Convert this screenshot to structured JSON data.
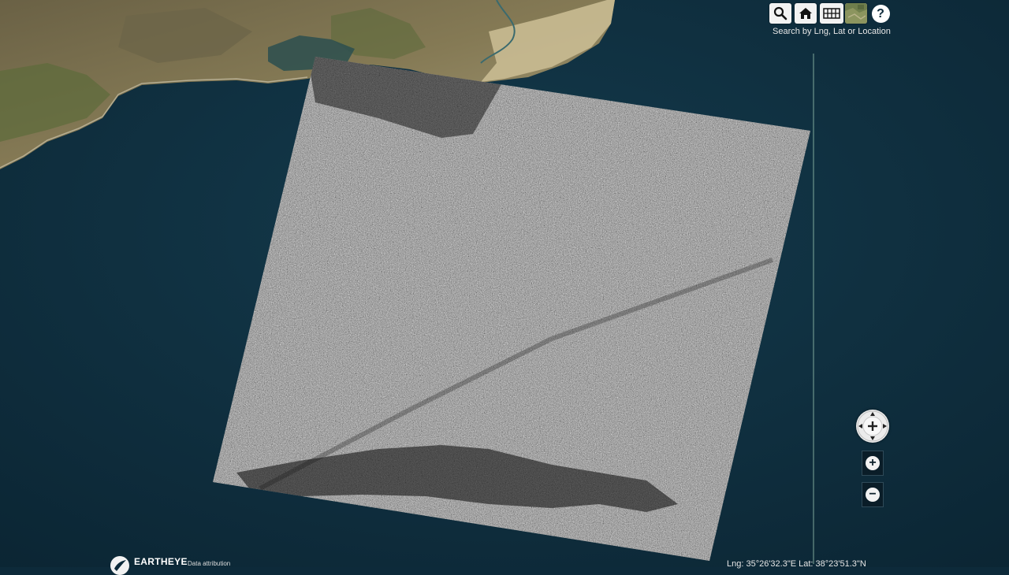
{
  "toolbar": {
    "search_hint": "Search by Lng, Lat or Location",
    "buttons": [
      "search-icon",
      "home-icon",
      "grid-icon",
      "basemap-thumbnail",
      "help-icon"
    ],
    "help_glyph": "?"
  },
  "navigation": {
    "pan_control": "pan-compass-icon",
    "zoom_in_glyph": "+",
    "zoom_out_glyph": "−"
  },
  "footer": {
    "logo_text": "EARTHEYE",
    "attribution": "Data attribution",
    "coordinates": "Lng: 35°26'32.3\"E  Lat: 38°23'51.3\"N"
  },
  "map": {
    "ocean_color": "#0d2a3a",
    "land_color": "#7b6e4c",
    "overlay_color": "#8a8a8a"
  }
}
